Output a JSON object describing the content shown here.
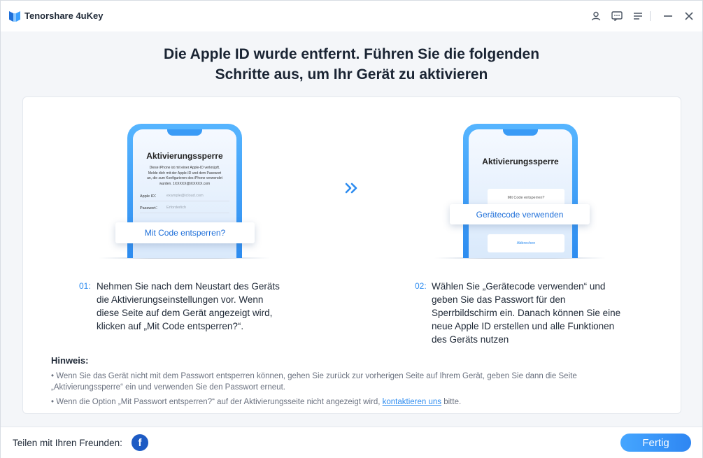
{
  "app": {
    "name": "Tenorshare 4uKey"
  },
  "titlebar": {
    "icons": [
      "user-icon",
      "feedback-icon",
      "menu-icon",
      "minimize-icon",
      "close-icon"
    ]
  },
  "heading": {
    "line1": "Die Apple ID wurde entfernt. Führen Sie die folgenden",
    "line2": "Schritte aus, um Ihr Gerät zu aktivieren"
  },
  "phone1": {
    "title": "Aktivierungssperre",
    "desc_line1": "Diese iPhone ist mit einer Apple-ID verknüpft.",
    "desc_line2": "Melde dich mit der Apple-ID und dem Passwort",
    "desc_line3": "an, die zum Konfigurieren des iPhone verwendet",
    "desc_line4": "wurden. 1XXXXX@iXXXXX.com",
    "apple_id_label": "Apple ID：",
    "apple_id_placeholder": "example@icloud.com",
    "password_label": "Passwort：",
    "password_placeholder": "Erforderlich",
    "popup_label": "Mit Code entsperren?"
  },
  "phone2": {
    "title": "Aktivierungssperre",
    "box1_label": "Mit Code entsperren?",
    "popup_label": "Gerätecode verwenden",
    "box2_label": "Abbrechen"
  },
  "steps": [
    {
      "num": "01:",
      "lines": [
        "Nehmen Sie nach dem Neustart des Geräts",
        "die Aktivierungseinstellungen vor. Wenn",
        "diese Seite auf dem Gerät angezeigt wird,",
        "klicken auf „Mit Code entsperren?“."
      ]
    },
    {
      "num": "02:",
      "lines": [
        "Wählen Sie „Gerätecode verwenden“ und",
        "geben Sie das Passwort für den",
        "Sperrbildschirm ein. Danach können Sie eine",
        "neue Apple ID erstellen und alle Funktionen",
        "des Geräts nutzen"
      ]
    }
  ],
  "note": {
    "title": "Hinweis:",
    "line1a": "• Wenn Sie das Gerät nicht mit dem Passwort entsperren können, gehen Sie zurück zur vorherigen Seite auf Ihrem Gerät, geben Sie dann die Seite",
    "line1b": "„Aktivierungssperre“ ein und verwenden Sie den Passwort erneut.",
    "line2_before": "• Wenn die Option „Mit Passwort entsperren?“ auf der Aktivierungsseite nicht angezeigt wird, ",
    "line2_link": "kontaktieren uns",
    "line2_after": " bitte."
  },
  "footer": {
    "share_label": "Teilen mit Ihren Freunden:",
    "facebook_glyph": "f",
    "done_label": "Fertig"
  },
  "colors": {
    "accent": "#2d8cf0",
    "facebook": "#1d5bc4"
  }
}
